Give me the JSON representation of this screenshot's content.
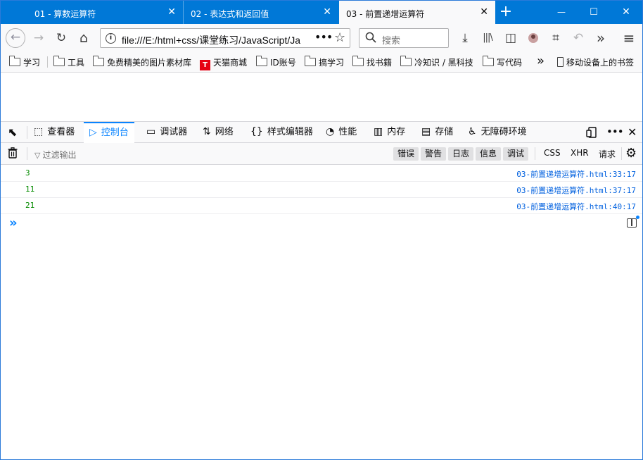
{
  "tabs": [
    {
      "title": "01 - 算数运算符",
      "close": "✕"
    },
    {
      "title": "02 - 表达式和返回值",
      "close": "✕"
    },
    {
      "title": "03 - 前置递增运算符",
      "close": "✕"
    }
  ],
  "newtab": "+",
  "window_controls": {
    "min": "—",
    "max": "☐",
    "close": "✕"
  },
  "nav": {
    "back": "←",
    "forward": "→",
    "reload": "↻",
    "home": "⌂",
    "url": "file:///E:/html+css/课堂练习/JavaScript/Ja",
    "info_icon": "i",
    "more": "•••",
    "star": "☆",
    "search_placeholder": "搜索",
    "download": "⤓",
    "library": "|||\\",
    "sidebar": "◫",
    "crop": "⌗",
    "undo": "↶",
    "overflow": "»",
    "menu": "≡"
  },
  "bookmarks": [
    {
      "label": "学习",
      "icon": "folder-icon"
    },
    {
      "label": "工具",
      "icon": "folder-icon"
    },
    {
      "label": "免费精美的图片素材库",
      "icon": "folder-icon"
    },
    {
      "label": "天猫商城",
      "icon": "tmall-icon",
      "icon_text": "T"
    },
    {
      "label": "ID账号",
      "icon": "folder-icon"
    },
    {
      "label": "搞学习",
      "icon": "folder-icon"
    },
    {
      "label": "找书籍",
      "icon": "folder-icon"
    },
    {
      "label": "冷知识 / 黑科技",
      "icon": "folder-icon"
    },
    {
      "label": "写代码",
      "icon": "folder-icon"
    }
  ],
  "bookmarks_overflow": "»",
  "mobile_bookmarks": "移动设备上的书签",
  "devtools": {
    "tabs": [
      {
        "label": "查看器",
        "icon": "⬚"
      },
      {
        "label": "控制台",
        "icon": "▷"
      },
      {
        "label": "调试器",
        "icon": "▭"
      },
      {
        "label": "网络",
        "icon": "⇅"
      },
      {
        "label": "样式编辑器",
        "icon": "{}"
      },
      {
        "label": "性能",
        "icon": "◔"
      },
      {
        "label": "内存",
        "icon": "▥"
      },
      {
        "label": "存储",
        "icon": "▤"
      },
      {
        "label": "无障碍环境",
        "icon": "♿"
      }
    ],
    "selected_tab": "控制台",
    "pick_icon": "⬉",
    "filter_placeholder": "过滤输出",
    "filter_chips": [
      "错误",
      "警告",
      "日志",
      "信息",
      "调试"
    ],
    "filter_plain": [
      "CSS",
      "XHR",
      "请求"
    ],
    "trash_icon": "🗑",
    "gear_icon": "⚙"
  },
  "console": [
    {
      "value": "3",
      "location": "03-前置递增运算符.html:33:17"
    },
    {
      "value": "11",
      "location": "03-前置递增运算符.html:37:17"
    },
    {
      "value": "21",
      "location": "03-前置递增运算符.html:40:17"
    }
  ],
  "prompt": "»"
}
